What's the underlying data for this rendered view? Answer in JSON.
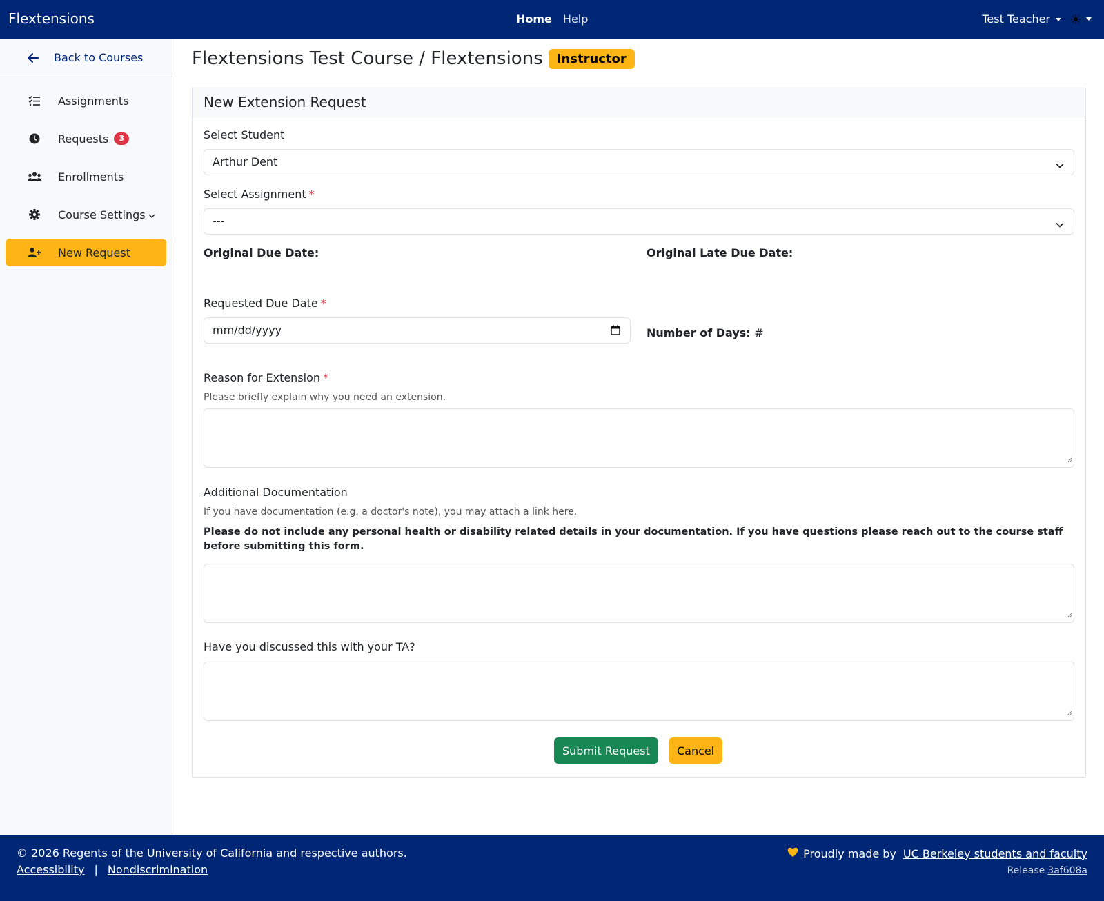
{
  "navbar": {
    "brand": "Flextensions",
    "links": {
      "home": "Home",
      "help": "Help"
    },
    "user": "Test Teacher",
    "theme_icon": "sun-icon"
  },
  "sidebar": {
    "back": {
      "label": "Back to Courses",
      "icon": "arrow-left-icon"
    },
    "items": [
      {
        "label": "Assignments",
        "icon": "list-check-icon"
      },
      {
        "label": "Requests",
        "icon": "clock-icon",
        "badge": "3"
      },
      {
        "label": "Enrollments",
        "icon": "users-icon"
      },
      {
        "label": "Course Settings",
        "icon": "gear-icon"
      },
      {
        "label": "New Request",
        "icon": "user-plus-icon",
        "active": true
      }
    ]
  },
  "page": {
    "title": "Flextensions Test Course / Flextensions",
    "role_badge": "Instructor"
  },
  "form": {
    "header": "New Extension Request",
    "student_label": "Select Student",
    "student_value": "Arthur Dent",
    "assignment_label": "Select Assignment",
    "assignment_value": "---",
    "required_mark": "*",
    "original_due_label": "Original Due Date:",
    "original_late_due_label": "Original Late Due Date:",
    "requested_due_label": "Requested Due Date",
    "requested_due_placeholder": "mm/dd/yyyy",
    "num_days_label": "Number of Days:",
    "num_days_value": "#",
    "reason_label": "Reason for Extension",
    "reason_help": "Please briefly explain why you need an extension.",
    "docs_label": "Additional Documentation",
    "docs_help": "If you have documentation (e.g. a doctor's note), you may attach a link here.",
    "docs_warning": "Please do not include any personal health or disability related details in your documentation. If you have questions please reach out to the course staff before submitting this form.",
    "ta_label": "Have you discussed this with your TA?",
    "submit_label": "Submit Request",
    "cancel_label": "Cancel"
  },
  "footer": {
    "copyright": "© 2026 Regents of the University of California and respective authors.",
    "accessibility": "Accessibility",
    "separator": "|",
    "nondiscrimination": "Nondiscrimination",
    "made_by_prefix": "Proudly made by",
    "made_by_link": "UC Berkeley students and faculty",
    "release_label": "Release",
    "release_hash": "3af608a"
  },
  "colors": {
    "navy": "#002676",
    "gold": "#FDB515",
    "success": "#198754",
    "danger": "#dc3545"
  }
}
